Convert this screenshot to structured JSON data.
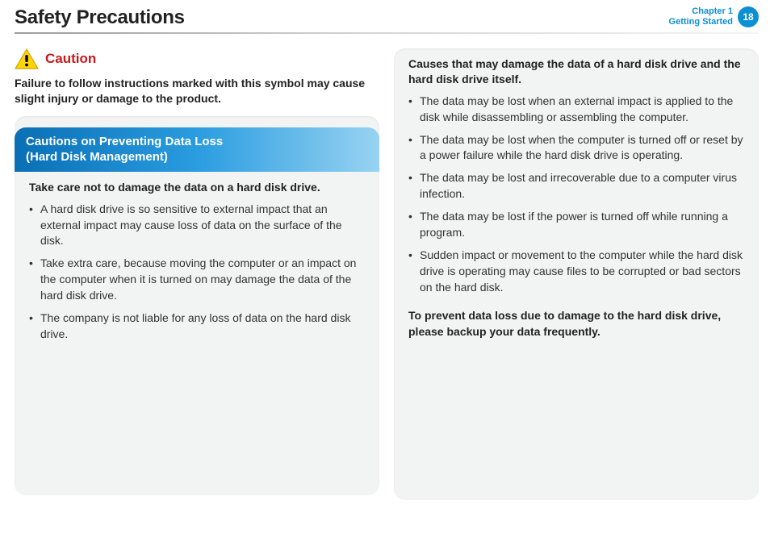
{
  "header": {
    "title": "Safety Precautions",
    "chapter_line1": "Chapter 1",
    "chapter_line2": "Getting Started",
    "page_number": "18"
  },
  "left": {
    "caution_label": "Caution",
    "caution_desc": "Failure to follow instructions marked with this symbol may cause slight injury or damage to the product.",
    "panel_heading": "Cautions on Preventing Data Loss\n(Hard Disk Management)",
    "section_title": "Take care not to damage the data on a hard disk drive.",
    "bullets": [
      "A hard disk drive is so sensitive to external impact that an external impact may cause loss of data on the surface of the disk.",
      "Take extra care, because moving the computer or an impact on the computer when it is turned on may damage the data of the hard disk drive.",
      "The company is not liable for any loss of data on the hard disk drive."
    ]
  },
  "right": {
    "section_title": "Causes that may damage the data of a hard disk drive and the hard disk drive itself.",
    "bullets": [
      "The data may be lost when an external impact is applied to the disk while disassembling or assembling the computer.",
      "The data may be lost when the computer is turned off or reset by a power failure while the hard disk drive is operating.",
      "The data may be lost and irrecoverable due to a computer virus infection.",
      "The data may be lost if the power is turned off while running a program.",
      "Sudden impact or movement to the computer while the hard disk drive is operating may cause files to be corrupted or bad sectors on the hard disk."
    ],
    "closing": "To prevent data loss due to damage to the hard disk drive, please backup your data frequently."
  }
}
